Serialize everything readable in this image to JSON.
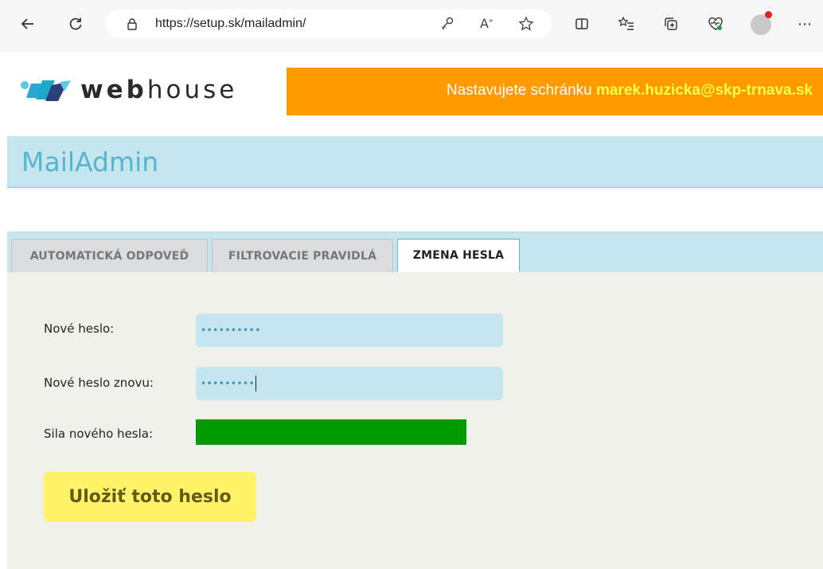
{
  "browser": {
    "url": "https://setup.sk/mailadmin/",
    "icons": [
      "back-arrow-icon",
      "refresh-icon",
      "lock-icon",
      "key-icon",
      "read-aloud-icon",
      "favorite-star-icon",
      "split-screen-icon",
      "favorites-list-icon",
      "collections-icon",
      "health-icon",
      "profile-avatar-icon",
      "more-menu-icon"
    ]
  },
  "header": {
    "logo_bold": "web",
    "logo_light": "house",
    "notice_prefix": "Nastavujete schránku",
    "notice_email": "marek.huzicka@skp-trnava.sk",
    "colors": {
      "accent_orange": "#ff9a00",
      "email_yellow": "#ffff4d",
      "band": "#c6e6ef",
      "title": "#58b5cf"
    }
  },
  "page": {
    "title": "MailAdmin"
  },
  "tabs": [
    {
      "label": "AUTOMATICKÁ ODPOVEĎ",
      "active": false
    },
    {
      "label": "FILTROVACIE PRAVIDLÁ",
      "active": false
    },
    {
      "label": "ZMENA HESLA",
      "active": true
    }
  ],
  "form": {
    "new_password_label": "Nové heslo:",
    "new_password_value": "••••••••••",
    "confirm_password_label": "Nové heslo znovu:",
    "confirm_password_value": "•••••••••",
    "strength_label": "Sila nového hesla:",
    "strength_fraction": 0.88,
    "strength_color": "#009900",
    "save_label": "Uložiť toto heslo"
  }
}
